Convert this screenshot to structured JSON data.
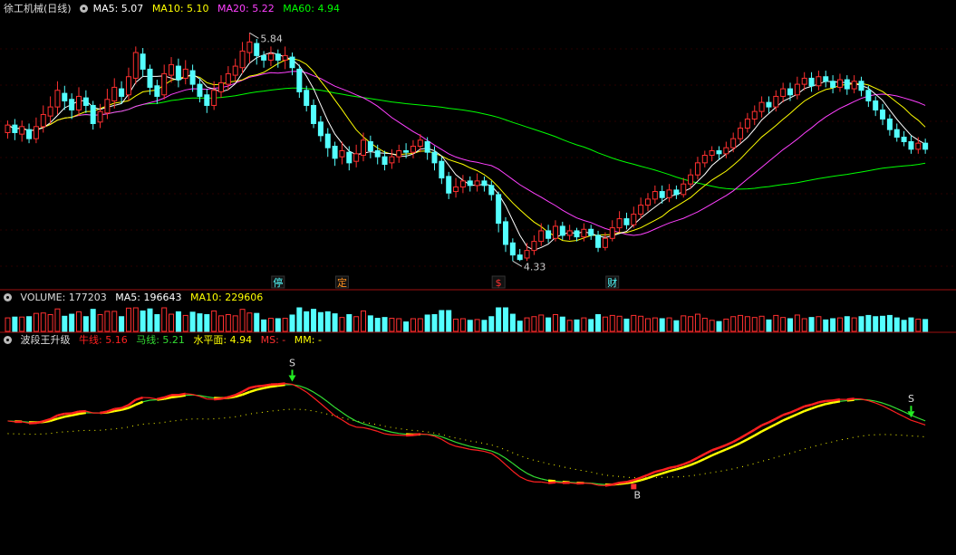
{
  "colors": {
    "up": "#ff3030",
    "down": "#54ffff",
    "ma5": "#ffffff",
    "ma10": "#ffff00",
    "ma20": "#ff40ff",
    "ma60": "#00ff00",
    "title": "#dddddd",
    "sep": "#a01010",
    "niu": "#ff2020",
    "ma_line": "#33dd33",
    "level": "#ffff00",
    "ms": "#ff3030",
    "mm": "#ffff00"
  },
  "main": {
    "title": "徐工机械(日线)",
    "gear_icon": "gear-icon",
    "ma5_text": "MA5: 5.07",
    "ma10_text": "MA10: 5.10",
    "ma20_text": "MA20: 5.22",
    "ma60_text": "MA60: 4.94",
    "high_label": "5.84",
    "low_label": "4.33",
    "markers": [
      {
        "label": "停",
        "color": "#54ffff",
        "index": 38
      },
      {
        "label": "定",
        "color": "#ff9020",
        "index": 47
      },
      {
        "label": "$",
        "color": "#ff3030",
        "index": 69
      },
      {
        "label": "财",
        "color": "#54ffff",
        "index": 85
      }
    ]
  },
  "volume": {
    "text": "VOLUME: 177203",
    "ma5_text": "MA5: 196643",
    "ma10_text": "MA10: 229606"
  },
  "indicator": {
    "name": "波段王升级",
    "niu_text": "牛线: 5.16",
    "ma_text": "马线: 5.21",
    "level_text": "水平面: 4.94",
    "ms_text": "MS: -",
    "mm_text": "MM: -",
    "signals": [
      {
        "label": "S",
        "index": 40,
        "type": "sell"
      },
      {
        "label": "B",
        "index": 88,
        "type": "buy"
      },
      {
        "label": "S",
        "index": 127,
        "type": "sell"
      }
    ]
  },
  "chart_data": {
    "type": "candlestick",
    "title": "徐工机械(日线)",
    "price_range": [
      4.2,
      5.95
    ],
    "high": 5.84,
    "low": 4.33,
    "candles": [
      [
        5.18,
        5.23,
        5.14,
        5.26
      ],
      [
        5.23,
        5.18,
        5.13,
        5.27
      ],
      [
        5.17,
        5.22,
        5.12,
        5.26
      ],
      [
        5.2,
        5.14,
        5.11,
        5.24
      ],
      [
        5.14,
        5.22,
        5.11,
        5.28
      ],
      [
        5.22,
        5.3,
        5.18,
        5.36
      ],
      [
        5.29,
        5.35,
        5.24,
        5.42
      ],
      [
        5.35,
        5.46,
        5.3,
        5.52
      ],
      [
        5.44,
        5.39,
        5.33,
        5.49
      ],
      [
        5.4,
        5.33,
        5.27,
        5.44
      ],
      [
        5.33,
        5.42,
        5.29,
        5.48
      ],
      [
        5.41,
        5.36,
        5.31,
        5.46
      ],
      [
        5.36,
        5.24,
        5.2,
        5.39
      ],
      [
        5.25,
        5.32,
        5.21,
        5.37
      ],
      [
        5.31,
        5.4,
        5.27,
        5.47
      ],
      [
        5.39,
        5.48,
        5.34,
        5.54
      ],
      [
        5.47,
        5.42,
        5.37,
        5.52
      ],
      [
        5.43,
        5.55,
        5.39,
        5.61
      ],
      [
        5.54,
        5.71,
        5.5,
        5.75
      ],
      [
        5.7,
        5.6,
        5.55,
        5.74
      ],
      [
        5.6,
        5.48,
        5.43,
        5.63
      ],
      [
        5.49,
        5.42,
        5.37,
        5.53
      ],
      [
        5.43,
        5.57,
        5.4,
        5.63
      ],
      [
        5.56,
        5.63,
        5.51,
        5.68
      ],
      [
        5.62,
        5.53,
        5.48,
        5.67
      ],
      [
        5.54,
        5.6,
        5.5,
        5.66
      ],
      [
        5.59,
        5.5,
        5.45,
        5.63
      ],
      [
        5.5,
        5.42,
        5.38,
        5.54
      ],
      [
        5.43,
        5.36,
        5.31,
        5.47
      ],
      [
        5.36,
        5.46,
        5.33,
        5.52
      ],
      [
        5.45,
        5.51,
        5.41,
        5.56
      ],
      [
        5.5,
        5.57,
        5.46,
        5.62
      ],
      [
        5.56,
        5.62,
        5.52,
        5.67
      ],
      [
        5.61,
        5.72,
        5.57,
        5.78
      ],
      [
        5.71,
        5.78,
        5.64,
        5.84
      ],
      [
        5.77,
        5.69,
        5.63,
        5.8
      ],
      [
        5.69,
        5.66,
        5.61,
        5.72
      ],
      [
        5.66,
        5.7,
        5.62,
        5.75
      ],
      [
        5.7,
        5.66,
        5.61,
        5.73
      ],
      [
        5.66,
        5.69,
        5.6,
        5.75
      ],
      [
        5.68,
        5.61,
        5.56,
        5.71
      ],
      [
        5.6,
        5.45,
        5.41,
        5.63
      ],
      [
        5.46,
        5.36,
        5.32,
        5.49
      ],
      [
        5.36,
        5.24,
        5.21,
        5.4
      ],
      [
        5.25,
        5.16,
        5.12,
        5.29
      ],
      [
        5.17,
        5.08,
        5.02,
        5.21
      ],
      [
        5.09,
        5.01,
        4.96,
        5.12
      ],
      [
        5.02,
        5.06,
        4.97,
        5.12
      ],
      [
        5.05,
        4.98,
        4.93,
        5.09
      ],
      [
        4.99,
        5.04,
        4.95,
        5.1
      ],
      [
        5.03,
        5.13,
        4.99,
        5.18
      ],
      [
        5.12,
        5.06,
        5.01,
        5.16
      ],
      [
        5.06,
        5.02,
        4.97,
        5.1
      ],
      [
        5.02,
        4.97,
        4.93,
        5.06
      ],
      [
        4.98,
        5.02,
        4.94,
        5.07
      ],
      [
        5.02,
        5.06,
        4.98,
        5.1
      ],
      [
        5.06,
        5.05,
        5.01,
        5.11
      ],
      [
        5.05,
        5.09,
        5.01,
        5.13
      ],
      [
        5.09,
        5.13,
        5.05,
        5.17
      ],
      [
        5.12,
        5.05,
        5.0,
        5.15
      ],
      [
        5.05,
        4.98,
        4.93,
        5.09
      ],
      [
        4.99,
        4.88,
        4.84,
        5.02
      ],
      [
        4.89,
        4.78,
        4.74,
        4.92
      ],
      [
        4.79,
        4.82,
        4.75,
        4.88
      ],
      [
        4.82,
        4.86,
        4.78,
        4.9
      ],
      [
        4.86,
        4.83,
        4.79,
        4.89
      ],
      [
        4.83,
        4.86,
        4.79,
        4.91
      ],
      [
        4.86,
        4.83,
        4.79,
        4.89
      ],
      [
        4.83,
        4.77,
        4.73,
        4.86
      ],
      [
        4.77,
        4.58,
        4.52,
        4.79
      ],
      [
        4.59,
        4.44,
        4.39,
        4.62
      ],
      [
        4.45,
        4.37,
        4.33,
        4.48
      ],
      [
        4.37,
        4.34,
        4.33,
        4.41
      ],
      [
        4.35,
        4.4,
        4.33,
        4.45
      ],
      [
        4.4,
        4.46,
        4.37,
        4.5
      ],
      [
        4.46,
        4.53,
        4.43,
        4.58
      ],
      [
        4.53,
        4.48,
        4.45,
        4.57
      ],
      [
        4.48,
        4.56,
        4.46,
        4.6
      ],
      [
        4.56,
        4.5,
        4.47,
        4.59
      ],
      [
        4.5,
        4.53,
        4.47,
        4.57
      ],
      [
        4.53,
        4.49,
        4.46,
        4.55
      ],
      [
        4.49,
        4.54,
        4.46,
        4.58
      ],
      [
        4.54,
        4.5,
        4.47,
        4.57
      ],
      [
        4.5,
        4.42,
        4.39,
        4.53
      ],
      [
        4.42,
        4.48,
        4.4,
        4.52
      ],
      [
        4.48,
        4.55,
        4.46,
        4.6
      ],
      [
        4.55,
        4.61,
        4.52,
        4.66
      ],
      [
        4.61,
        4.57,
        4.54,
        4.65
      ],
      [
        4.57,
        4.64,
        4.55,
        4.69
      ],
      [
        4.64,
        4.7,
        4.61,
        4.75
      ],
      [
        4.7,
        4.74,
        4.66,
        4.78
      ],
      [
        4.74,
        4.79,
        4.71,
        4.83
      ],
      [
        4.79,
        4.75,
        4.71,
        4.83
      ],
      [
        4.75,
        4.8,
        4.72,
        4.84
      ],
      [
        4.8,
        4.77,
        4.74,
        4.83
      ],
      [
        4.77,
        4.84,
        4.75,
        4.88
      ],
      [
        4.84,
        4.9,
        4.81,
        4.94
      ],
      [
        4.9,
        4.98,
        4.87,
        5.02
      ],
      [
        4.98,
        5.03,
        4.95,
        5.06
      ],
      [
        5.03,
        5.06,
        4.99,
        5.09
      ],
      [
        5.06,
        5.04,
        5.0,
        5.09
      ],
      [
        5.04,
        5.08,
        5.01,
        5.12
      ],
      [
        5.08,
        5.14,
        5.05,
        5.18
      ],
      [
        5.14,
        5.21,
        5.11,
        5.25
      ],
      [
        5.21,
        5.27,
        5.18,
        5.31
      ],
      [
        5.27,
        5.32,
        5.23,
        5.36
      ],
      [
        5.32,
        5.38,
        5.28,
        5.42
      ],
      [
        5.38,
        5.35,
        5.31,
        5.42
      ],
      [
        5.35,
        5.42,
        5.32,
        5.46
      ],
      [
        5.42,
        5.47,
        5.38,
        5.51
      ],
      [
        5.47,
        5.43,
        5.39,
        5.51
      ],
      [
        5.43,
        5.5,
        5.4,
        5.55
      ],
      [
        5.5,
        5.54,
        5.46,
        5.58
      ],
      [
        5.54,
        5.49,
        5.45,
        5.58
      ],
      [
        5.49,
        5.55,
        5.46,
        5.59
      ],
      [
        5.55,
        5.52,
        5.48,
        5.59
      ],
      [
        5.52,
        5.48,
        5.44,
        5.56
      ],
      [
        5.48,
        5.53,
        5.45,
        5.57
      ],
      [
        5.53,
        5.47,
        5.43,
        5.56
      ],
      [
        5.47,
        5.52,
        5.44,
        5.56
      ],
      [
        5.52,
        5.46,
        5.42,
        5.55
      ],
      [
        5.46,
        5.39,
        5.35,
        5.49
      ],
      [
        5.39,
        5.33,
        5.29,
        5.42
      ],
      [
        5.33,
        5.27,
        5.23,
        5.37
      ],
      [
        5.27,
        5.2,
        5.16,
        5.3
      ],
      [
        5.2,
        5.15,
        5.12,
        5.24
      ],
      [
        5.15,
        5.12,
        5.09,
        5.19
      ],
      [
        5.12,
        5.07,
        5.04,
        5.16
      ],
      [
        5.07,
        5.11,
        5.04,
        5.15
      ],
      [
        5.11,
        5.07,
        5.04,
        5.14
      ]
    ],
    "ma": [
      {
        "name": "MA5",
        "value": 5.07
      },
      {
        "name": "MA10",
        "value": 5.1
      },
      {
        "name": "MA20",
        "value": 5.22
      },
      {
        "name": "MA60",
        "value": 4.94
      }
    ],
    "volume_values": {
      "VOLUME": 177203,
      "MA5": 196643,
      "MA10": 229606
    },
    "indicator_values": {
      "牛线": 5.16,
      "马线": 5.21,
      "水平面": 4.94
    }
  }
}
